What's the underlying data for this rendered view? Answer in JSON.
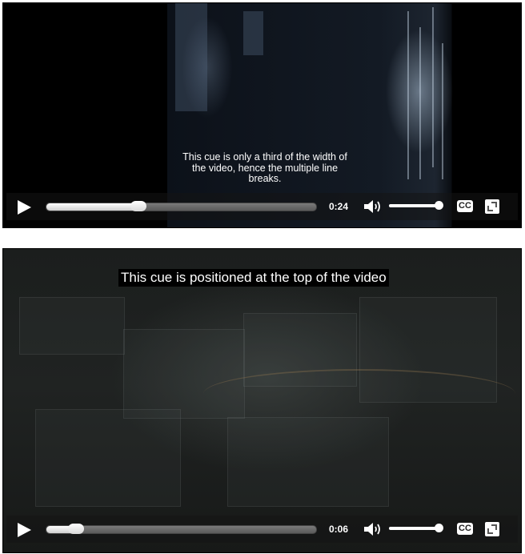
{
  "players": [
    {
      "caption": "This cue is only a third of the width of the video, hence the multiple line breaks.",
      "time": "0:24",
      "progress_fraction": 0.34,
      "volume_fraction": 0.96,
      "cc_label": "CC"
    },
    {
      "caption": "This cue is positioned at the top of the video",
      "time": "0:06",
      "progress_fraction": 0.11,
      "volume_fraction": 0.96,
      "cc_label": "CC"
    }
  ],
  "icons": {
    "play": "play-icon",
    "volume": "speaker-volume-icon",
    "captions": "closed-captions-icon",
    "fullscreen": "fullscreen-icon"
  }
}
